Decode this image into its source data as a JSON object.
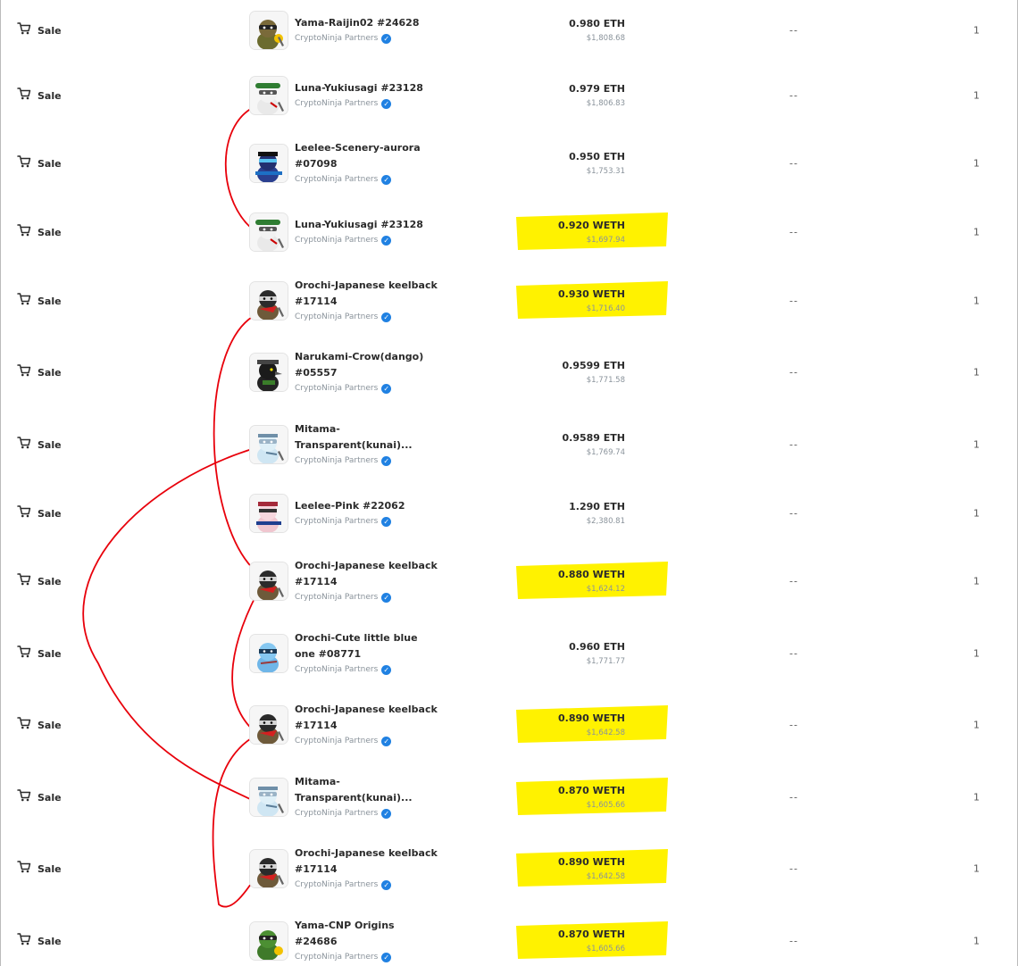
{
  "activity": {
    "rows": [
      {
        "event": "Sale",
        "name": "Yama-Raijin02 #24628",
        "collection": "CryptoNinja Partners",
        "price": "0.980 ETH",
        "usd": "$1,808.68",
        "from": "--",
        "quantity": "1",
        "art": "yama"
      },
      {
        "event": "Sale",
        "name": "Luna-Yukiusagi #23128",
        "collection": "CryptoNinja Partners",
        "price": "0.979 ETH",
        "usd": "$1,806.83",
        "from": "--",
        "quantity": "1",
        "art": "luna"
      },
      {
        "event": "Sale",
        "name": "Leelee-Scenery-aurora #07098",
        "collection": "CryptoNinja Partners",
        "price": "0.950 ETH",
        "usd": "$1,753.31",
        "from": "--",
        "quantity": "1",
        "art": "leelee-aurora"
      },
      {
        "event": "Sale",
        "name": "Luna-Yukiusagi #23128",
        "collection": "CryptoNinja Partners",
        "price": "0.920 WETH",
        "usd": "$1,697.94",
        "from": "--",
        "quantity": "1",
        "art": "luna"
      },
      {
        "event": "Sale",
        "name": "Orochi-Japanese keelback #17114",
        "collection": "CryptoNinja Partners",
        "price": "0.930 WETH",
        "usd": "$1,716.40",
        "from": "--",
        "quantity": "1",
        "art": "orochi"
      },
      {
        "event": "Sale",
        "name": "Narukami-Crow(dango) #05557",
        "collection": "CryptoNinja Partners",
        "price": "0.9599 ETH",
        "usd": "$1,771.58",
        "from": "--",
        "quantity": "1",
        "art": "crow"
      },
      {
        "event": "Sale",
        "name": "Mitama-Transparent(kunai)...",
        "collection": "CryptoNinja Partners",
        "price": "0.9589 ETH",
        "usd": "$1,769.74",
        "from": "--",
        "quantity": "1",
        "art": "mitama"
      },
      {
        "event": "Sale",
        "name": "Leelee-Pink #22062",
        "collection": "CryptoNinja Partners",
        "price": "1.290 ETH",
        "usd": "$2,380.81",
        "from": "--",
        "quantity": "1",
        "art": "leelee-pink"
      },
      {
        "event": "Sale",
        "name": "Orochi-Japanese keelback #17114",
        "collection": "CryptoNinja Partners",
        "price": "0.880 WETH",
        "usd": "$1,624.12",
        "from": "--",
        "quantity": "1",
        "art": "orochi"
      },
      {
        "event": "Sale",
        "name": "Orochi-Cute little blue one #08771",
        "collection": "CryptoNinja Partners",
        "price": "0.960 ETH",
        "usd": "$1,771.77",
        "from": "--",
        "quantity": "1",
        "art": "orochi-blue"
      },
      {
        "event": "Sale",
        "name": "Orochi-Japanese keelback #17114",
        "collection": "CryptoNinja Partners",
        "price": "0.890 WETH",
        "usd": "$1,642.58",
        "from": "--",
        "quantity": "1",
        "art": "orochi"
      },
      {
        "event": "Sale",
        "name": "Mitama-Transparent(kunai)...",
        "collection": "CryptoNinja Partners",
        "price": "0.870 WETH",
        "usd": "$1,605.66",
        "from": "--",
        "quantity": "1",
        "art": "mitama"
      },
      {
        "event": "Sale",
        "name": "Orochi-Japanese keelback #17114",
        "collection": "CryptoNinja Partners",
        "price": "0.890 WETH",
        "usd": "$1,642.58",
        "from": "--",
        "quantity": "1",
        "art": "orochi"
      },
      {
        "event": "Sale",
        "name": "Yama-CNP Origins #24686",
        "collection": "CryptoNinja Partners",
        "price": "0.870 WETH",
        "usd": "$1,605.66",
        "from": "--",
        "quantity": "1",
        "art": "yama-green"
      }
    ]
  },
  "annotations": {
    "highlight_color": "#fff200",
    "connector_color": "#e8000b",
    "highlighted_rows": [
      3,
      4,
      8,
      10,
      11,
      12,
      13
    ],
    "connections": [
      {
        "from_row": 1,
        "to_row": 3
      },
      {
        "from_row": 4,
        "to_row": 8
      },
      {
        "from_row": 6,
        "to_row": 11
      },
      {
        "from_row": 8,
        "to_row": 10
      },
      {
        "from_row": 10,
        "to_row": 12
      }
    ]
  }
}
